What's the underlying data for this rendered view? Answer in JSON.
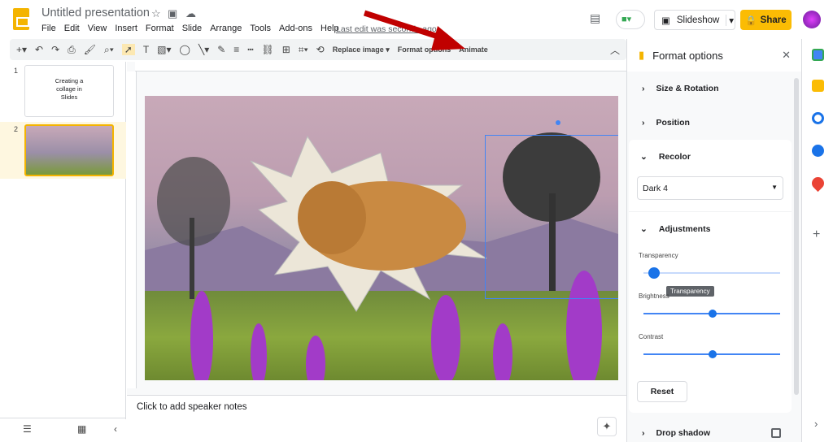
{
  "header": {
    "title": "Untitled presentation",
    "last_edit": "Last edit was seconds ago",
    "slideshow_label": "Slideshow",
    "share_label": "Share"
  },
  "menu": [
    "File",
    "Edit",
    "View",
    "Insert",
    "Format",
    "Slide",
    "Arrange",
    "Tools",
    "Add-ons",
    "Help"
  ],
  "toolbar": {
    "replace_image": "Replace image",
    "format_options": "Format options",
    "animate": "Animate"
  },
  "filmstrip": {
    "slides": [
      {
        "number": "1",
        "text": "Creating a collage in Slides"
      },
      {
        "number": "2",
        "text": ""
      }
    ]
  },
  "notes": {
    "placeholder": "Click to add speaker notes"
  },
  "panel": {
    "title": "Format options",
    "sections": {
      "size": "Size & Rotation",
      "position": "Position",
      "recolor": "Recolor",
      "adjustments": "Adjustments",
      "drop_shadow": "Drop shadow"
    },
    "recolor_value": "Dark 4",
    "sliders": [
      {
        "label": "Transparency",
        "value": 0.08
      },
      {
        "label": "Brightness",
        "value": 0.5
      },
      {
        "label": "Contrast",
        "value": 0.5
      }
    ],
    "tooltip": "Transparency",
    "reset_label": "Reset",
    "drop_shadow_checked": false
  },
  "colors": {
    "accent": "#1a73e8",
    "share": "#fbbc04",
    "arrow": "#c00000"
  }
}
